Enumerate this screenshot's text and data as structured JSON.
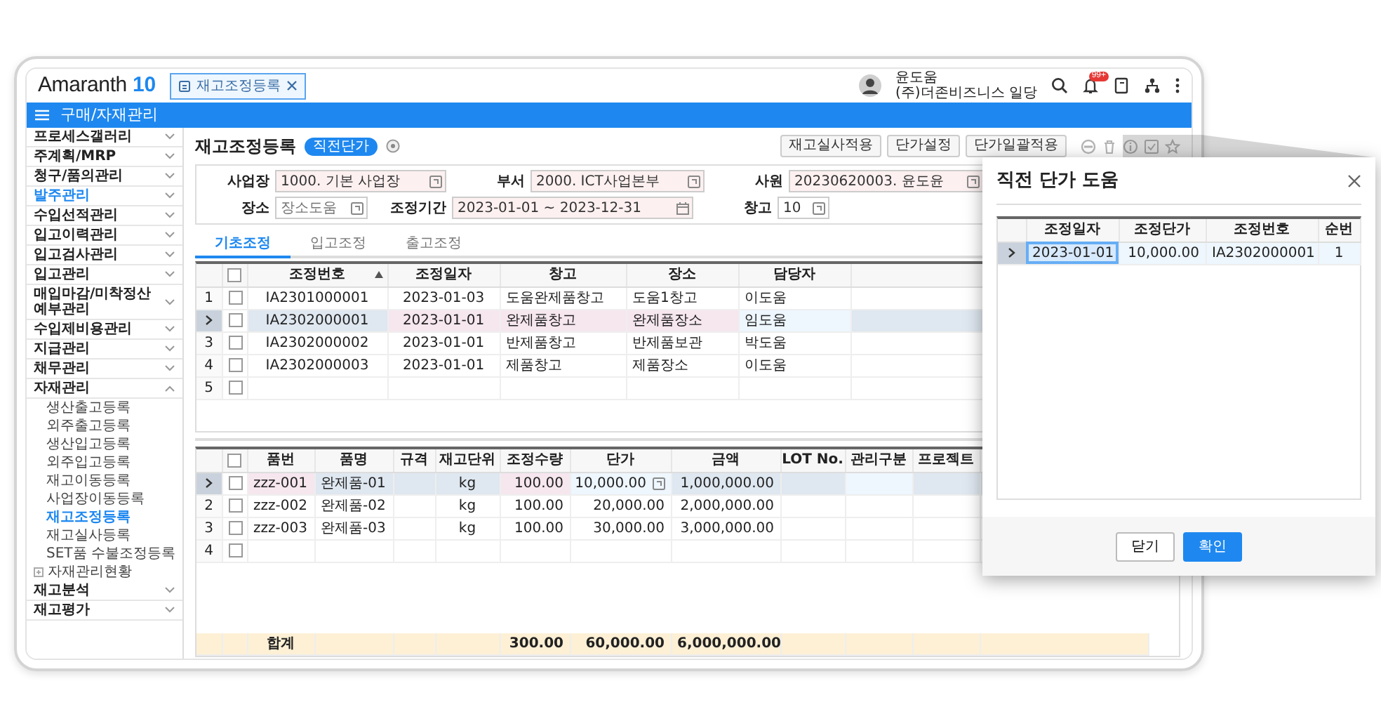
{
  "header": {
    "logo_text": "Amaranth",
    "logo_version": "10",
    "open_tabs": [
      {
        "label": "재고조정등록",
        "selected": true
      }
    ],
    "user": {
      "name": "윤도움",
      "company": "(주)더존비즈니스 일당"
    },
    "notification_count": "99+"
  },
  "module_bar": {
    "title": "구매/자재관리"
  },
  "sidebar": {
    "items": [
      {
        "label": "프로세스갤러리",
        "selected": false,
        "expanded": false
      },
      {
        "label": "주계획/MRP",
        "selected": false,
        "expanded": false
      },
      {
        "label": "청구/품의관리",
        "selected": false,
        "expanded": false
      },
      {
        "label": "발주관리",
        "selected": true,
        "expanded": false
      },
      {
        "label": "수입선적관리",
        "selected": false,
        "expanded": false
      },
      {
        "label": "입고이력관리",
        "selected": false,
        "expanded": false
      },
      {
        "label": "입고검사관리",
        "selected": false,
        "expanded": false
      },
      {
        "label": "입고관리",
        "selected": false,
        "expanded": false
      },
      {
        "label": "매입마감/미착정산예부관리",
        "selected": false,
        "expanded": false
      },
      {
        "label": "수입제비용관리",
        "selected": false,
        "expanded": false
      },
      {
        "label": "지급관리",
        "selected": false,
        "expanded": false
      },
      {
        "label": "채무관리",
        "selected": false,
        "expanded": false
      },
      {
        "label": "자재관리",
        "selected": false,
        "expanded": true,
        "children": [
          {
            "label": "생산출고등록",
            "selected": false,
            "kind": "page"
          },
          {
            "label": "외주출고등록",
            "selected": false,
            "kind": "page"
          },
          {
            "label": "생산입고등록",
            "selected": false,
            "kind": "page"
          },
          {
            "label": "외주입고등록",
            "selected": false,
            "kind": "page"
          },
          {
            "label": "재고이동등록",
            "selected": false,
            "kind": "page"
          },
          {
            "label": "사업장이동등록",
            "selected": false,
            "kind": "page"
          },
          {
            "label": "재고조정등록",
            "selected": true,
            "kind": "page"
          },
          {
            "label": "재고실사등록",
            "selected": false,
            "kind": "page"
          },
          {
            "label": "SET품 수불조정등록",
            "selected": false,
            "kind": "page"
          },
          {
            "label": "자재관리현황",
            "selected": false,
            "kind": "folder"
          }
        ]
      },
      {
        "label": "재고분석",
        "selected": false,
        "expanded": false
      },
      {
        "label": "재고평가",
        "selected": false,
        "expanded": false
      }
    ]
  },
  "page": {
    "title": "재고조정등록",
    "badge": "직전단가",
    "actions": [
      "재고실사적용",
      "단가설정",
      "단가일괄적용"
    ],
    "filter_rows": [
      [
        {
          "label": "사업장",
          "value": "1000. 기본 사업장",
          "required": true,
          "kind": "lookup"
        },
        {
          "label": "부서",
          "value": "2000. ICT사업본부",
          "required": true,
          "kind": "lookup"
        },
        {
          "label": "사원",
          "value": "20230620003. 윤도윤",
          "required": true,
          "kind": "lookup"
        }
      ],
      [
        {
          "label": "장소",
          "placeholder": "장소도움",
          "required": false,
          "kind": "lookup"
        },
        {
          "label": "조정기간",
          "value": "2023-01-01 ~ 2023-12-31",
          "required": true,
          "kind": "date"
        },
        {
          "label": "창고",
          "value": "10",
          "required": false,
          "kind": "lookup"
        }
      ]
    ],
    "tabs": [
      {
        "label": "기초조정",
        "selected": true
      },
      {
        "label": "입고조정",
        "selected": false
      },
      {
        "label": "출고조정",
        "selected": false
      }
    ],
    "header_grid": {
      "all_checked": false,
      "columns": [
        {
          "label": "조정번호",
          "sorted": true
        },
        {
          "label": "조정일자",
          "sorted": false
        },
        {
          "label": "창고",
          "sorted": false
        },
        {
          "label": "장소",
          "sorted": false
        },
        {
          "label": "담당자",
          "sorted": false
        }
      ],
      "rows": [
        {
          "number": "1",
          "selected": false,
          "checked": false,
          "cells": [
            "IA2301000001",
            "2023-01-03",
            "도움완제품창고",
            "도움1창고",
            "이도움"
          ]
        },
        {
          "selected": true,
          "checked": false,
          "cells": [
            "IA2302000001",
            "2023-01-01",
            "완제품창고",
            "완제품장소",
            "임도움"
          ]
        },
        {
          "number": "3",
          "selected": false,
          "checked": false,
          "cells": [
            "IA2302000002",
            "2023-01-01",
            "반제품창고",
            "반제품보관",
            "박도움"
          ]
        },
        {
          "number": "4",
          "selected": false,
          "checked": false,
          "cells": [
            "IA2302000003",
            "2023-01-01",
            "제품창고",
            "제품장소",
            "이도움"
          ]
        },
        {
          "number": "5",
          "selected": false,
          "checked": false
        }
      ]
    },
    "detail_grid": {
      "all_checked": false,
      "columns": [
        {
          "label": "품번",
          "sorted": false
        },
        {
          "label": "품명",
          "sorted": false
        },
        {
          "label": "규격",
          "sorted": false
        },
        {
          "label": "재고단위",
          "sorted": false
        },
        {
          "label": "조정수량",
          "sorted": false
        },
        {
          "label": "단가",
          "sorted": false
        },
        {
          "label": "금액",
          "sorted": false
        },
        {
          "label": "LOT No.",
          "sorted": false
        },
        {
          "label": "관리구분",
          "sorted": false
        },
        {
          "label": "프로젝트",
          "sorted": false
        }
      ],
      "rows": [
        {
          "selected": true,
          "checked": false,
          "cells": [
            "zzz-001",
            "완제품-01",
            null,
            "kg",
            "100.00",
            "10,000.00",
            "1,000,000.00"
          ]
        },
        {
          "number": "2",
          "selected": false,
          "checked": false,
          "cells": [
            "zzz-002",
            "완제품-02",
            null,
            "kg",
            "100.00",
            "20,000.00",
            "2,000,000.00"
          ]
        },
        {
          "number": "3",
          "selected": false,
          "checked": false,
          "cells": [
            "zzz-003",
            "완제품-03",
            null,
            "kg",
            "100.00",
            "30,000.00",
            "3,000,000.00"
          ]
        },
        {
          "number": "4",
          "selected": false,
          "checked": false
        }
      ],
      "totals": {
        "label": "합계",
        "values": [
          "300.00",
          "60,000.00",
          "6,000,000.00"
        ]
      }
    }
  },
  "dialog": {
    "title": "직전 단가 도움",
    "columns": [
      "조정일자",
      "조정단가",
      "조정번호",
      "순번"
    ],
    "rows": [
      {
        "selected": true,
        "cells": [
          {
            "text": "2023-01-01",
            "focused": true
          },
          {
            "text": "10,000.00",
            "focused": false
          },
          {
            "text": "IA2302000001",
            "focused": false
          },
          {
            "text": "1",
            "focused": false
          }
        ]
      }
    ],
    "buttons": [
      {
        "label": "닫기",
        "kind": "secondary"
      },
      {
        "label": "확인",
        "kind": "primary"
      }
    ]
  }
}
